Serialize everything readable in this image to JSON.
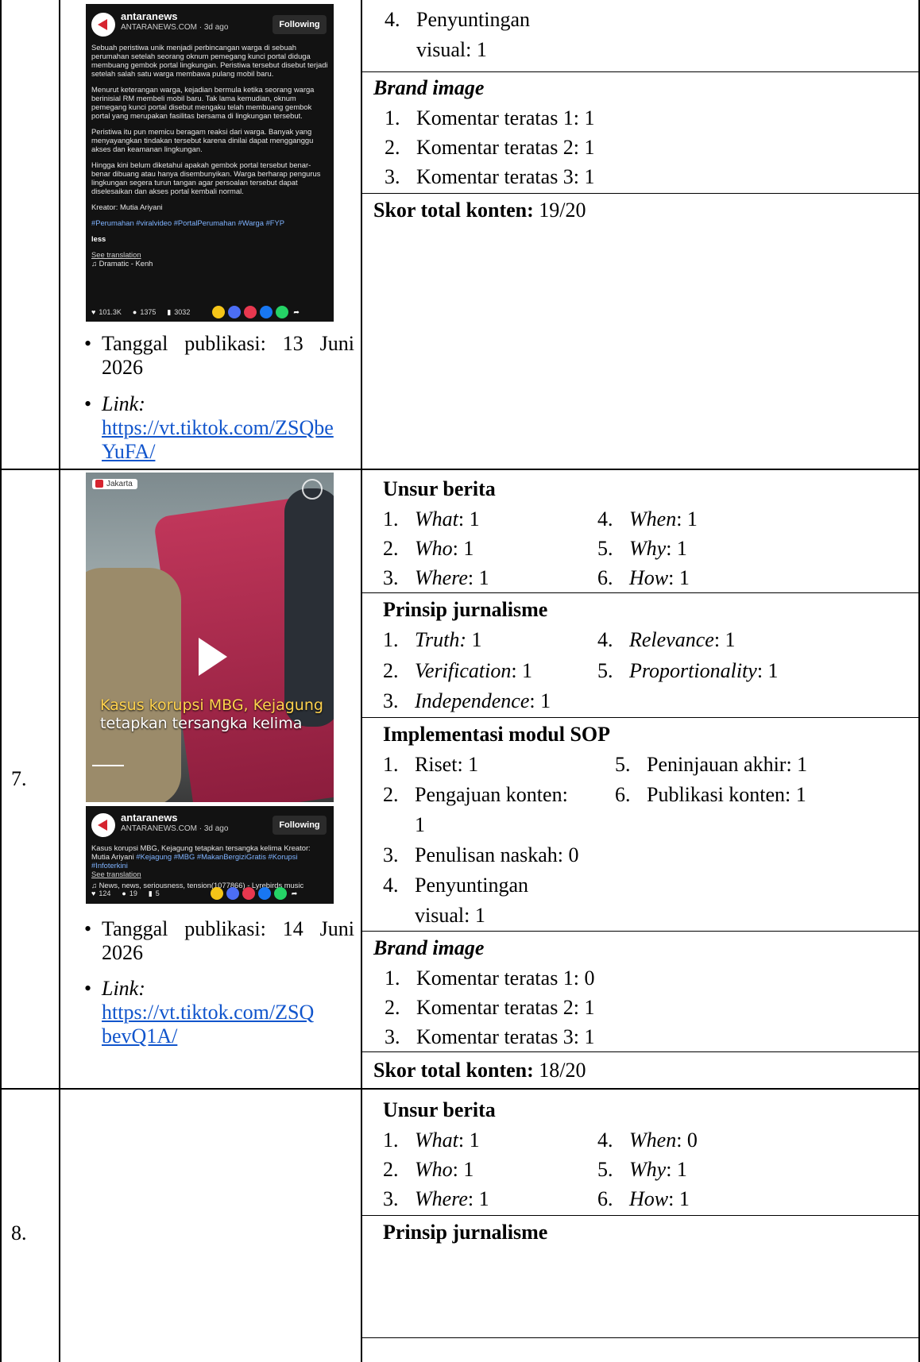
{
  "row6": {
    "post": {
      "account": "antaranews",
      "source_time": "ANTARANEWS.COM · 3d ago",
      "follow_label": "Following",
      "caption_paragraphs": [
        "Sebuah peristiwa unik menjadi perbincangan warga di sebuah perumahan setelah seorang oknum pemegang kunci portal diduga membuang gembok portal lingkungan. Peristiwa tersebut disebut terjadi setelah salah satu warga membawa pulang mobil baru.",
        "Menurut keterangan warga, kejadian bermula ketika seorang warga berinisial RM membeli mobil baru. Tak lama kemudian, oknum pemegang kunci portal disebut mengaku telah membuang gembok portal yang merupakan fasilitas bersama di lingkungan tersebut.",
        "Peristiwa itu pun memicu beragam reaksi dari warga. Banyak yang menyayangkan tindakan tersebut karena dinilai dapat mengganggu akses dan keamanan lingkungan.",
        "Hingga kini belum diketahui apakah gembok portal tersebut benar-benar dibuang atau hanya disembunyikan. Warga berharap pengurus lingkungan segera turun tangan agar persoalan tersebut dapat diselesaikan dan akses portal kembali normal."
      ],
      "creator": "Kreator: Mutia Ariyani",
      "hashtags": "#Perumahan #viralvideo #PortalPerumahan #Warga #FYP",
      "less": "less",
      "see_translation": "See translation",
      "music": "♫  Dramatic - Kenh",
      "likes": "101.3K",
      "comments": "1375",
      "saves": "3032"
    },
    "tanggal": "Tanggal publikasi: 13 Juni",
    "tanggal_year": "2026",
    "link_label": "Link:",
    "link_line1": "https://vt.tiktok.com/ZSQbe",
    "link_line2": "YuFA/",
    "sop_items": [
      {
        "n": "4.",
        "text": "Penyuntingan"
      },
      {
        "n": "",
        "text": "visual: 1"
      }
    ],
    "brand_title": "Brand image",
    "brand_items": [
      {
        "n": "1.",
        "text": "Komentar teratas 1: 1"
      },
      {
        "n": "2.",
        "text": "Komentar teratas 2: 1"
      },
      {
        "n": "3.",
        "text": "Komentar teratas 3: 1"
      }
    ],
    "score_label": "Skor total konten:",
    "score_value": " 19/20"
  },
  "row7": {
    "number": "7.",
    "video": {
      "location": "Jakarta",
      "headline_line1": "Kasus korupsi MBG, Kejagung",
      "headline_line2": "tetapkan tersangka kelima"
    },
    "post": {
      "account": "antaranews",
      "source_time": "ANTARANEWS.COM · 3d ago",
      "follow_label": "Following",
      "caption": "Kasus korupsi MBG, Kejagung tetapkan tersangka kelima Kreator: Mutia Ariyani ",
      "hashtags": "#Kejagung #MBG #MakanBergiziGratis #Korupsi #Infoterkini",
      "see_translation": "See translation",
      "music": "♫  News, news, seriousness, tension(1077866) - Lyrebirds music",
      "likes": "124",
      "comments": "19",
      "saves": "5"
    },
    "tanggal": "Tanggal publikasi: 14 Juni",
    "tanggal_year": "2026",
    "link_label": "Link:",
    "link_line1": "https://vt.tiktok.com/ZSQ",
    "link_line2": "bevQ1A/",
    "unsur_title": "Unsur berita",
    "unsur_left": [
      {
        "n": "1.",
        "k": "What",
        "v": ": 1"
      },
      {
        "n": "2.",
        "k": "Who",
        "v": ": 1"
      },
      {
        "n": "3.",
        "k": "Where",
        "v": ": 1"
      }
    ],
    "unsur_right": [
      {
        "n": "4.",
        "k": "When",
        "v": ": 1"
      },
      {
        "n": "5.",
        "k": "Why",
        "v": ": 1"
      },
      {
        "n": "6.",
        "k": "How",
        "v": ": 1"
      }
    ],
    "prinsip_title": "Prinsip jurnalisme",
    "prinsip_left": [
      {
        "n": "1.",
        "k": "Truth:",
        "v": " 1"
      },
      {
        "n": "2.",
        "k": "Verification",
        "v": ": 1"
      },
      {
        "n": "3.",
        "k": "Independence",
        "v": ": 1"
      }
    ],
    "prinsip_right": [
      {
        "n": "4.",
        "k": "Relevance",
        "v": ": 1"
      },
      {
        "n": "5.",
        "k": "Proportionality",
        "v": ": 1"
      }
    ],
    "sop_title": "Implementasi modul SOP",
    "sop_left": [
      {
        "n": "1.",
        "text": "Riset: 1"
      },
      {
        "n": "2.",
        "text": "Pengajuan   konten:"
      },
      {
        "n": "",
        "text": "1"
      },
      {
        "n": "3.",
        "text": "Penulisan naskah: 0"
      },
      {
        "n": "4.",
        "text": "Penyuntingan"
      },
      {
        "n": "",
        "text": "visual: 1"
      }
    ],
    "sop_right": [
      {
        "n": "5.",
        "text": "Peninjauan akhir: 1"
      },
      {
        "n": "6.",
        "text": "Publikasi konten: 1"
      }
    ],
    "brand_title": "Brand image",
    "brand_items": [
      {
        "n": "1.",
        "text": "Komentar teratas 1: 0"
      },
      {
        "n": "2.",
        "text": "Komentar teratas 2: 1"
      },
      {
        "n": "3.",
        "text": "Komentar teratas 3: 1"
      }
    ],
    "score_label": "Skor total konten:",
    "score_value": " 18/20"
  },
  "row8": {
    "number": "8.",
    "unsur_title": "Unsur berita",
    "unsur_left": [
      {
        "n": "1.",
        "k": "What",
        "v": ": 1"
      },
      {
        "n": "2.",
        "k": "Who",
        "v": ": 1"
      },
      {
        "n": "3.",
        "k": "Where",
        "v": ": 1"
      }
    ],
    "unsur_right": [
      {
        "n": "4.",
        "k": "When",
        "v": ": 0"
      },
      {
        "n": "5.",
        "k": "Why",
        "v": ": 1"
      },
      {
        "n": "6.",
        "k": "How",
        "v": ": 1"
      }
    ],
    "prinsip_title": "Prinsip jurnalisme"
  },
  "colors": {
    "link": "#1155cc",
    "tiktok_bg": "#121212",
    "accent_red": "#d6242f"
  }
}
